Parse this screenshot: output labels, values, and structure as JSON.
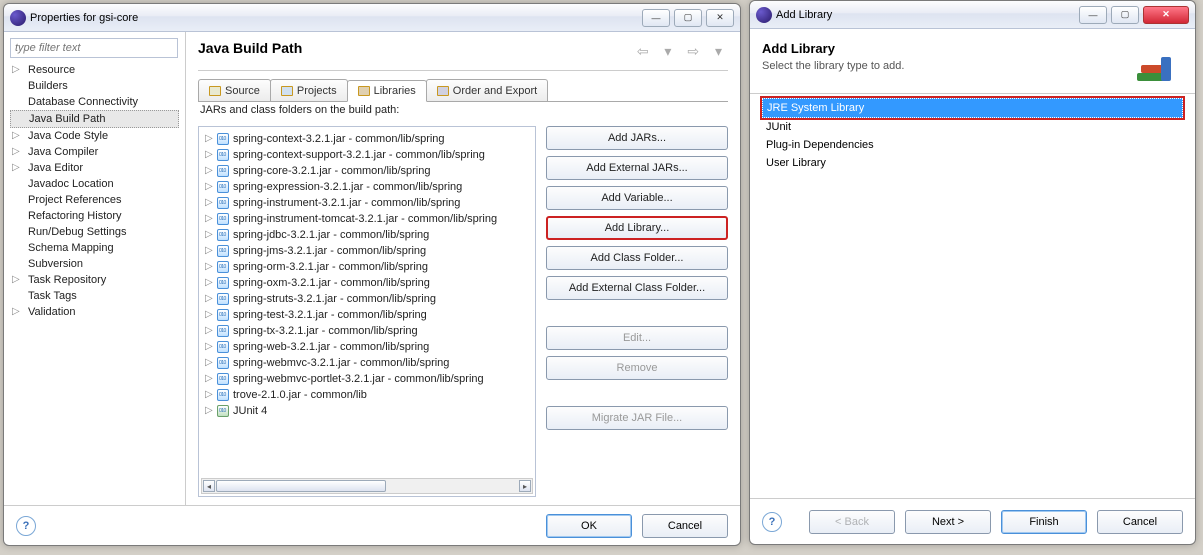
{
  "props": {
    "title": "Properties for gsi-core",
    "filter_placeholder": "type filter text",
    "categories": [
      {
        "label": "Resource",
        "exp": true
      },
      {
        "label": "Builders"
      },
      {
        "label": "Database Connectivity"
      },
      {
        "label": "Java Build Path",
        "selected": true
      },
      {
        "label": "Java Code Style",
        "exp": true
      },
      {
        "label": "Java Compiler",
        "exp": true
      },
      {
        "label": "Java Editor",
        "exp": true
      },
      {
        "label": "Javadoc Location"
      },
      {
        "label": "Project References"
      },
      {
        "label": "Refactoring History"
      },
      {
        "label": "Run/Debug Settings"
      },
      {
        "label": "Schema Mapping"
      },
      {
        "label": "Subversion"
      },
      {
        "label": "Task Repository",
        "exp": true
      },
      {
        "label": "Task Tags"
      },
      {
        "label": "Validation",
        "exp": true
      }
    ],
    "page_title": "Java Build Path",
    "tabs": [
      {
        "label": "Source"
      },
      {
        "label": "Projects"
      },
      {
        "label": "Libraries",
        "active": true
      },
      {
        "label": "Order and Export"
      }
    ],
    "list_heading": "JARs and class folders on the build path:",
    "jars": [
      "spring-context-3.2.1.jar - common/lib/spring",
      "spring-context-support-3.2.1.jar - common/lib/spring",
      "spring-core-3.2.1.jar - common/lib/spring",
      "spring-expression-3.2.1.jar - common/lib/spring",
      "spring-instrument-3.2.1.jar - common/lib/spring",
      "spring-instrument-tomcat-3.2.1.jar - common/lib/spring",
      "spring-jdbc-3.2.1.jar - common/lib/spring",
      "spring-jms-3.2.1.jar - common/lib/spring",
      "spring-orm-3.2.1.jar - common/lib/spring",
      "spring-oxm-3.2.1.jar - common/lib/spring",
      "spring-struts-3.2.1.jar - common/lib/spring",
      "spring-test-3.2.1.jar - common/lib/spring",
      "spring-tx-3.2.1.jar - common/lib/spring",
      "spring-web-3.2.1.jar - common/lib/spring",
      "spring-webmvc-3.2.1.jar - common/lib/spring",
      "spring-webmvc-portlet-3.2.1.jar - common/lib/spring",
      "trove-2.1.0.jar - common/lib"
    ],
    "junit": "JUnit 4",
    "buttons": {
      "add_jars": "Add JARs...",
      "add_ext_jars": "Add External JARs...",
      "add_var": "Add Variable...",
      "add_lib": "Add Library...",
      "add_class": "Add Class Folder...",
      "add_ext_class": "Add External Class Folder...",
      "edit": "Edit...",
      "remove": "Remove",
      "migrate": "Migrate JAR File..."
    },
    "ok": "OK",
    "cancel": "Cancel"
  },
  "addlib": {
    "title": "Add Library",
    "heading": "Add Library",
    "desc": "Select the library type to add.",
    "items": [
      {
        "label": "JRE System Library",
        "selected": true,
        "highlight": true
      },
      {
        "label": "JUnit"
      },
      {
        "label": "Plug-in Dependencies"
      },
      {
        "label": "User Library"
      }
    ],
    "back": "< Back",
    "next": "Next >",
    "finish": "Finish",
    "cancel": "Cancel"
  }
}
